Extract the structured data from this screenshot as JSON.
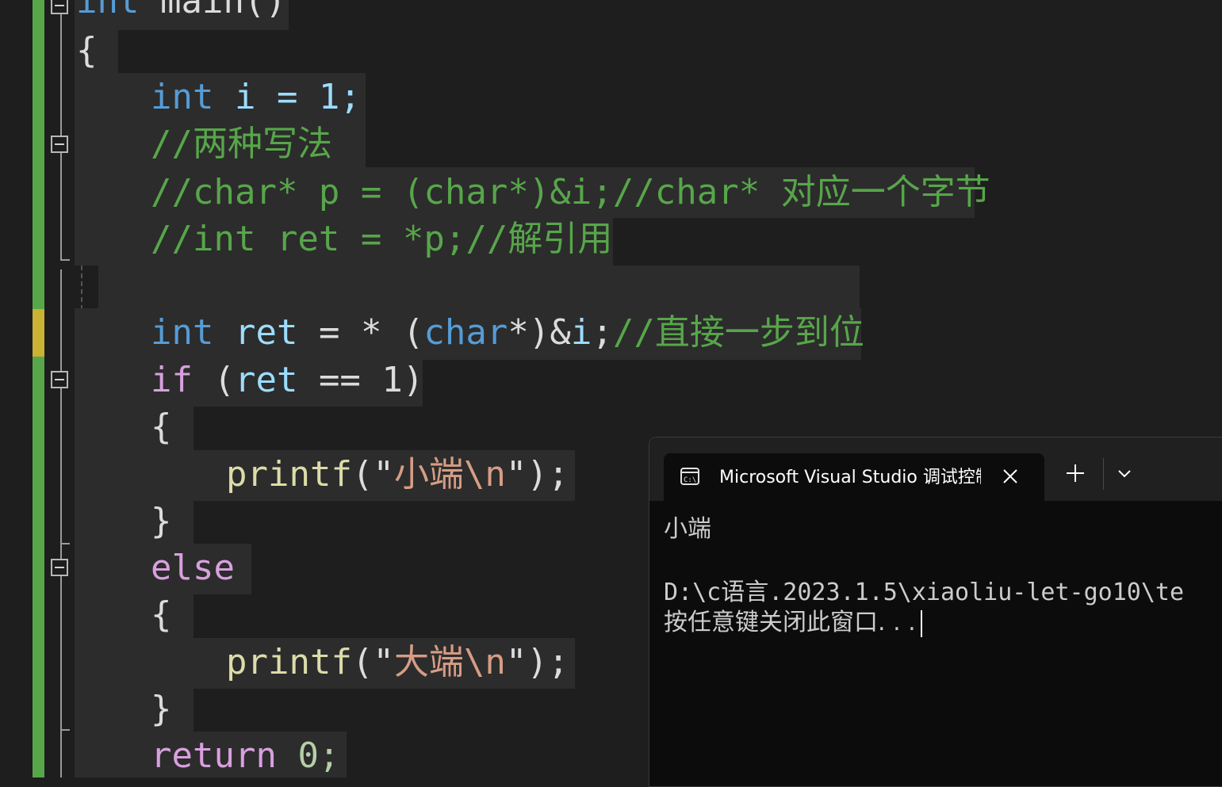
{
  "code": {
    "l0": [
      "int",
      " main()"
    ],
    "l1": "{",
    "l2": [
      "int",
      " i = 1;"
    ],
    "l3": "//两种写法",
    "l4": "//char* p = (char*)&i;//char* 对应一个字节",
    "l5": "//int ret = *p;//解引用",
    "l7": [
      "int",
      " ",
      "ret",
      " = * (",
      "char",
      "*)&",
      "i",
      ";",
      "//直接一步到位"
    ],
    "l8": [
      "if",
      " (",
      "ret",
      " == 1)"
    ],
    "l9": "{",
    "l10": [
      "printf",
      "(\"",
      "小端\\n",
      "\")",
      ";"
    ],
    "l11": "}",
    "l12": "else",
    "l13": "{",
    "l14": [
      "printf",
      "(\"",
      "大端\\n",
      "\")",
      ";"
    ],
    "l15": "}",
    "l16": [
      "return",
      " 0;"
    ]
  },
  "terminal": {
    "tab_title": "Microsoft Visual Studio 调试控制台",
    "new_tab_icon": "plus-icon",
    "dropdown_icon": "chevron-down-icon",
    "close_icon": "close-icon",
    "app_icon": "console-icon",
    "output_line1": "小端",
    "output_line2": "D:\\c语言.2023.1.5\\xiaoliu-let-go10\\te",
    "output_line3": "按任意键关闭此窗口. . ."
  },
  "colors": {
    "keyword": "#569cd6",
    "control_keyword": "#d8a0df",
    "comment": "#57a64a",
    "string": "#d69d85",
    "function": "#dcdcaa",
    "variable": "#9cdcfe",
    "number": "#b5cea8",
    "change_bar_saved": "#57a64a",
    "change_bar_unsaved": "#c9b234"
  }
}
